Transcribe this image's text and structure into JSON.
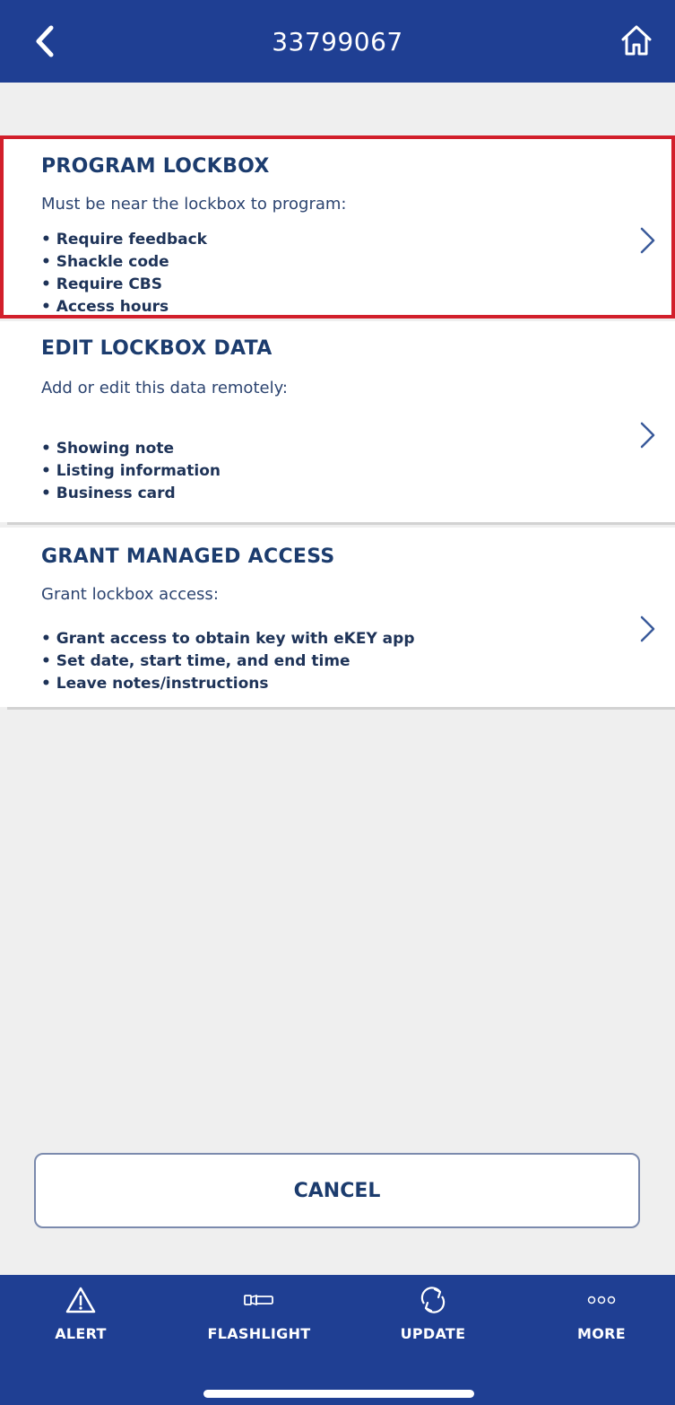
{
  "header": {
    "title": "33799067",
    "back_icon": "chevron-left-icon",
    "home_icon": "home-icon"
  },
  "options": [
    {
      "title": "PROGRAM LOCKBOX",
      "description": "Must be near the lockbox to program:",
      "bullets": [
        "• Require feedback",
        "• Shackle code",
        "• Require CBS",
        "• Access hours"
      ],
      "highlighted": true
    },
    {
      "title": "EDIT LOCKBOX DATA",
      "description": "Add or edit this data remotely:",
      "bullets": [
        "• Showing note",
        "• Listing information",
        "• Business card"
      ],
      "highlighted": false
    },
    {
      "title": "GRANT MANAGED ACCESS",
      "description": "Grant lockbox access:",
      "bullets": [
        "• Grant access to obtain key with eKEY app",
        "• Set date, start time, and end time",
        "• Leave notes/instructions"
      ],
      "highlighted": false
    }
  ],
  "cancel_label": "CANCEL",
  "tabbar": {
    "alert": "ALERT",
    "flashlight": "FLASHLIGHT",
    "update": "UPDATE",
    "more": "MORE"
  },
  "colors": {
    "brand": "#1f3f93",
    "highlight": "#d21f2b",
    "text": "#1c3c6e"
  }
}
